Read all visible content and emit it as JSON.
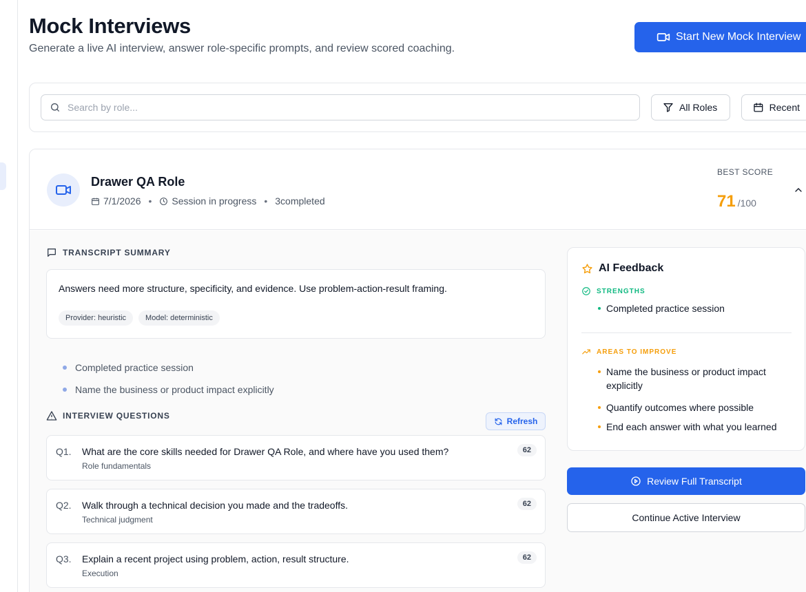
{
  "header": {
    "title": "Mock Interviews",
    "subtitle": "Generate a live AI interview, answer role-specific prompts, and review scored coaching.",
    "new_interview_label": "Start New Mock Interview"
  },
  "filters": {
    "search_placeholder": "Search by role...",
    "roles_label": "All Roles",
    "sort_label": "Recent"
  },
  "session": {
    "title": "Drawer QA Role",
    "date": "7/1/2026",
    "status": "Session in progress",
    "completed": "3completed",
    "best_score_label": "BEST SCORE",
    "best_score": "71",
    "best_score_max": "/100",
    "transcript_heading": "TRANSCRIPT SUMMARY",
    "summary": "Answers need more structure, specificity, and evidence. Use problem-action-result framing.",
    "provider_chip": "Provider: heuristic",
    "model_chip": "Model: deterministic",
    "bullets": [
      "Completed practice session",
      "Name the business or product impact explicitly"
    ],
    "questions_heading": "INTERVIEW QUESTIONS",
    "refresh_label": "Refresh",
    "questions": [
      {
        "num": "Q1.",
        "text": "What are the core skills needed for Drawer QA Role, and where have you used them?",
        "category": "Role fundamentals",
        "score": "62"
      },
      {
        "num": "Q2.",
        "text": "Walk through a technical decision you made and the tradeoffs.",
        "category": "Technical judgment",
        "score": "62"
      },
      {
        "num": "Q3.",
        "text": "Explain a recent project using problem, action, result structure.",
        "category": "Execution",
        "score": "62"
      }
    ]
  },
  "feedback": {
    "title": "AI Feedback",
    "strengths_heading": "STRENGTHS",
    "strengths": [
      "Completed practice session"
    ],
    "improve_heading": "AREAS TO IMPROVE",
    "improve": [
      "Name the business or product impact explicitly",
      "Quantify outcomes where possible",
      "End each answer with what you learned"
    ],
    "review_label": "Review Full Transcript",
    "continue_label": "Continue Active Interview"
  },
  "colors": {
    "accent": "#2563eb",
    "score": "#f59e0b",
    "strength": "#10b981",
    "improve": "#f59e0b"
  }
}
